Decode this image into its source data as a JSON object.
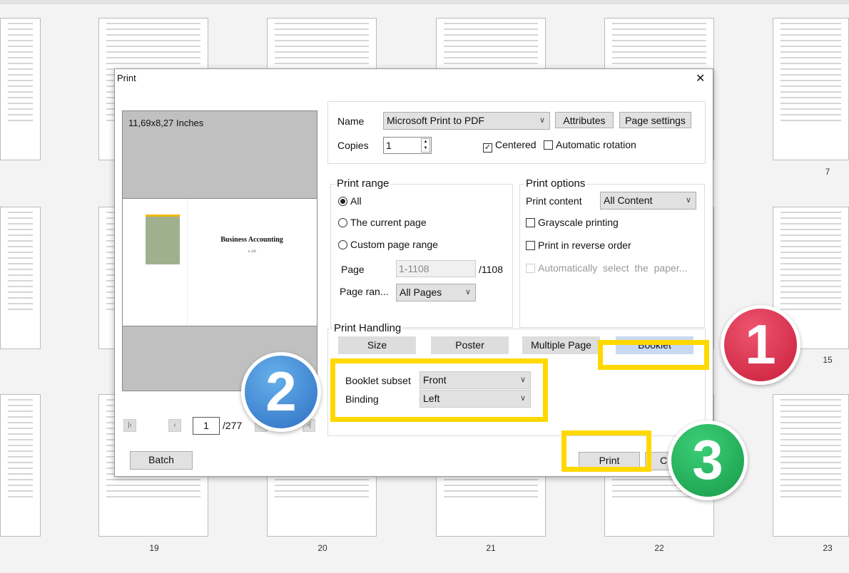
{
  "background": {
    "page_numbers": [
      "7",
      "15",
      "19",
      "20",
      "21",
      "22",
      "23"
    ],
    "preview_title": "Business Accounting",
    "preview_version": "v. 2.0"
  },
  "dialog": {
    "title": "Print",
    "close": "✕",
    "paper_size": "11,69x8,27 Inches",
    "printer": {
      "name_label": "Name",
      "name_value": "Microsoft Print to PDF",
      "attributes": "Attributes",
      "page_settings": "Page settings",
      "copies_label": "Copies",
      "copies_value": "1",
      "centered": "Centered",
      "centered_checked": true,
      "auto_rotation": "Automatic rotation",
      "auto_rotation_checked": false
    },
    "print_range": {
      "legend": "Print range",
      "all": "All",
      "current": "The current page",
      "custom": "Custom page range",
      "page_label": "Page",
      "page_placeholder": "1-1108",
      "page_total": "/1108",
      "range_label": "Page ran...",
      "range_value": "All Pages",
      "selected": "All"
    },
    "print_options": {
      "legend": "Print options",
      "content_label": "Print content",
      "content_value": "All Content",
      "grayscale": "Grayscale printing",
      "reverse": "Print in reverse order",
      "auto_paper": "Automatically  select  the  paper..."
    },
    "handling": {
      "legend": "Print Handling",
      "modes": [
        "Size",
        "Poster",
        "Multiple Page",
        "Booklet"
      ],
      "active": "Booklet",
      "subset_label": "Booklet subset",
      "subset_value": "Front",
      "binding_label": "Binding",
      "binding_value": "Left"
    },
    "nav": {
      "current_page": "1",
      "total": "/277"
    },
    "batch": "Batch",
    "print": "Print",
    "cancel": "C"
  },
  "annotations": {
    "steps": [
      "1",
      "2",
      "3"
    ],
    "colors": {
      "step1": "#d42a45",
      "step2": "#3b82d0",
      "step3": "#22b05a",
      "highlight": "#ffd800"
    }
  }
}
